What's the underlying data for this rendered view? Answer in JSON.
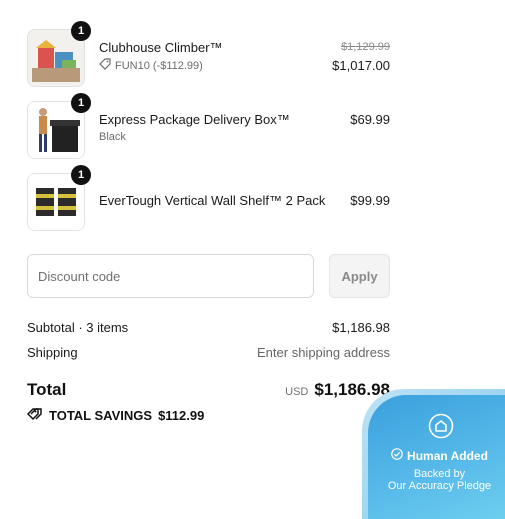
{
  "items": [
    {
      "qty": "1",
      "name": "Clubhouse Climber™",
      "discount": "FUN10 (-$112.99)",
      "original_price": "$1,129.99",
      "price": "$1,017.00"
    },
    {
      "qty": "1",
      "name": "Express Package Delivery Box™",
      "variant": "Black",
      "price": "$69.99"
    },
    {
      "qty": "1",
      "name": "EverTough Vertical Wall Shelf™ 2 Pack",
      "price": "$99.99"
    }
  ],
  "discount": {
    "placeholder": "Discount code",
    "apply_label": "Apply"
  },
  "summary": {
    "subtotal_label": "Subtotal · 3 items",
    "subtotal_value": "$1,186.98",
    "shipping_label": "Shipping",
    "shipping_value": "Enter shipping address",
    "total_label": "Total",
    "currency": "USD",
    "total_value": "$1,186.98",
    "savings_label": "TOTAL SAVINGS",
    "savings_value": "$112.99"
  },
  "badge": {
    "title": "Human Added",
    "line1": "Backed by",
    "line2": "Our Accuracy Pledge"
  },
  "colors": {
    "badge_accent": "#3aa0dc",
    "apply_bg": "#f4f4f4"
  }
}
